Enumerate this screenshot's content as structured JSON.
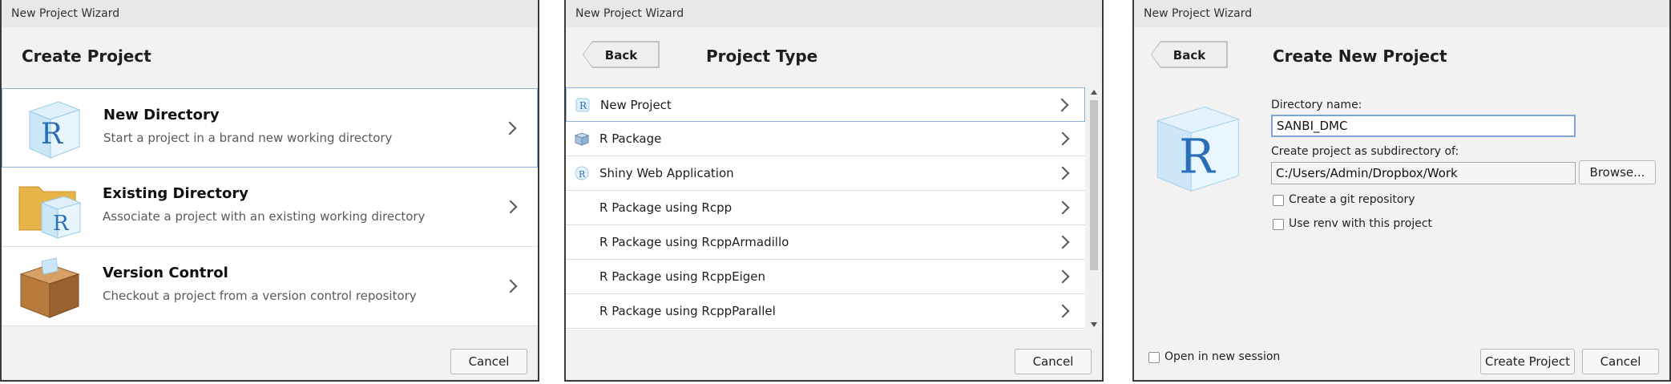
{
  "panel1": {
    "window_title": "New Project Wizard",
    "heading": "Create Project",
    "options": [
      {
        "title": "New Directory",
        "description": "Start a project in a brand new working directory",
        "icon": "r-cube-icon"
      },
      {
        "title": "Existing Directory",
        "description": "Associate a project with an existing working directory",
        "icon": "folder-r-icon"
      },
      {
        "title": "Version Control",
        "description": "Checkout a project from a version control repository",
        "icon": "box-icon"
      }
    ],
    "cancel_label": "Cancel"
  },
  "panel2": {
    "window_title": "New Project Wizard",
    "back_label": "Back",
    "heading": "Project Type",
    "items": [
      {
        "label": "New Project",
        "icon": "r-project-icon"
      },
      {
        "label": "R Package",
        "icon": "package-icon"
      },
      {
        "label": "Shiny Web Application",
        "icon": "shiny-icon"
      },
      {
        "label": "R Package using Rcpp",
        "icon": ""
      },
      {
        "label": "R Package using RcppArmadillo",
        "icon": ""
      },
      {
        "label": "R Package using RcppEigen",
        "icon": ""
      },
      {
        "label": "R Package using RcppParallel",
        "icon": ""
      }
    ],
    "cancel_label": "Cancel"
  },
  "panel3": {
    "window_title": "New Project Wizard",
    "back_label": "Back",
    "heading": "Create New Project",
    "dir_name_label": "Directory name:",
    "dir_name_value": "SANBI_DMC",
    "subdir_label": "Create project as subdirectory of:",
    "subdir_value": "C:/Users/Admin/Dropbox/Work",
    "browse_label": "Browse...",
    "git_label": "Create a git repository",
    "renv_label": "Use renv with this project",
    "new_session_label": "Open in new session",
    "create_label": "Create Project",
    "cancel_label": "Cancel"
  },
  "colors": {
    "selection_border": "#8fb4dc",
    "r_blue": "#2a6fb5",
    "folder": "#e7b44a",
    "box": "#b87a3c"
  }
}
